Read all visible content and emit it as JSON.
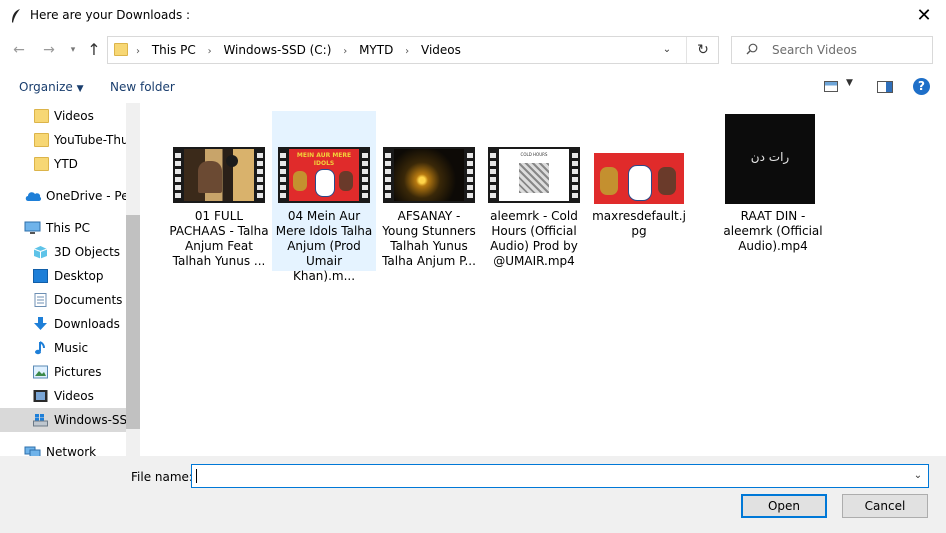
{
  "window": {
    "title": "Here are your Downloads :"
  },
  "nav": {
    "back_icon": "arrow-left-icon",
    "forward_icon": "arrow-right-icon",
    "recent_icon": "chevron-down-icon",
    "up_icon": "arrow-up-icon"
  },
  "address": {
    "crumbs": [
      "This PC",
      "Windows-SSD (C:)",
      "MYTD",
      "Videos"
    ]
  },
  "search": {
    "placeholder": "Search Videos"
  },
  "toolbar": {
    "organize": "Organize",
    "new_folder": "New folder"
  },
  "sidebar": {
    "items": [
      {
        "label": "Videos",
        "icon": "folder-icon"
      },
      {
        "label": "YouTube-Thu",
        "icon": "folder-icon"
      },
      {
        "label": "YTD",
        "icon": "folder-icon"
      },
      {
        "label": "OneDrive - Per",
        "icon": "cloud-icon"
      },
      {
        "label": "This PC",
        "icon": "computer-icon"
      },
      {
        "label": "3D Objects",
        "icon": "cube-icon"
      },
      {
        "label": "Desktop",
        "icon": "desktop-icon"
      },
      {
        "label": "Documents",
        "icon": "document-icon"
      },
      {
        "label": "Downloads",
        "icon": "download-icon"
      },
      {
        "label": "Music",
        "icon": "music-icon"
      },
      {
        "label": "Pictures",
        "icon": "picture-icon"
      },
      {
        "label": "Videos",
        "icon": "video-icon"
      },
      {
        "label": "Windows-SSD",
        "icon": "drive-icon"
      },
      {
        "label": "Network",
        "icon": "network-icon"
      }
    ]
  },
  "files": [
    {
      "label": "01 FULL PACHAAS - Talha Anjum Feat Talhah Yunus ...",
      "type": "video"
    },
    {
      "label": "04 Mein Aur Mere Idols  Talha Anjum (Prod Umair Khan).m...",
      "type": "video",
      "thumb_text": "MEIN AUR MERE IDOLS"
    },
    {
      "label": "AFSANAY - Young Stunners Talhah Yunus Talha Anjum  P...",
      "type": "video"
    },
    {
      "label": "aleemrk - Cold Hours (Official Audio)  Prod by @UMAIR.mp4",
      "type": "video",
      "thumb_text": "COLD HOURS"
    },
    {
      "label": "maxresdefault.jpg",
      "type": "image"
    },
    {
      "label": "RAAT DIN - aleemrk (Official Audio).mp4",
      "type": "video",
      "thumb_text": "رات دن"
    }
  ],
  "bottom": {
    "filename_label": "File name:",
    "filename_value": "",
    "open_label": "Open",
    "cancel_label": "Cancel"
  },
  "colors": {
    "accent": "#0078d7",
    "selection": "#e5f3ff",
    "sidebar_selected": "#d9d9d9"
  }
}
